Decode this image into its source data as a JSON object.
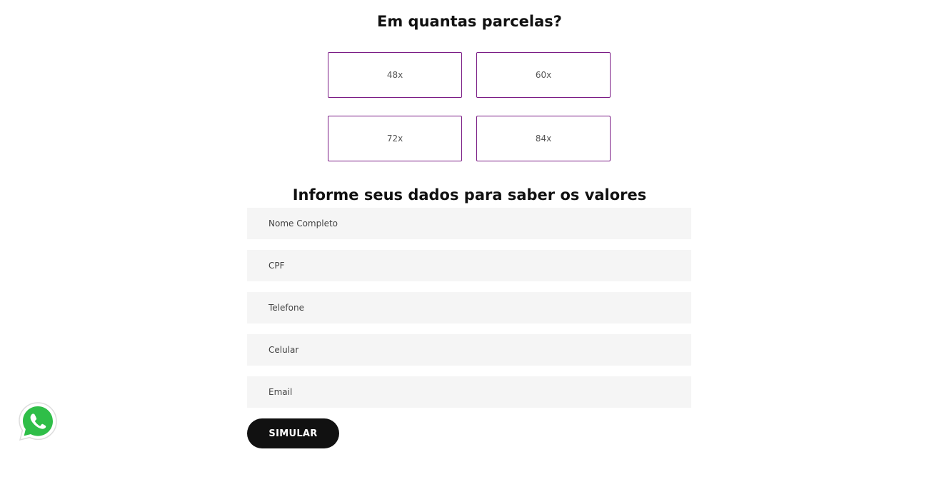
{
  "installments": {
    "title": "Em quantas parcelas?",
    "options": [
      {
        "label": "48x"
      },
      {
        "label": "60x"
      },
      {
        "label": "72x"
      },
      {
        "label": "84x"
      }
    ],
    "accent_color": "#7a1b85"
  },
  "form": {
    "title": "Informe seus dados para saber os valores",
    "fields": [
      {
        "placeholder": "Nome Completo"
      },
      {
        "placeholder": "CPF"
      },
      {
        "placeholder": "Telefone"
      },
      {
        "placeholder": "Celular"
      },
      {
        "placeholder": "Email"
      }
    ],
    "submit_label": "SIMULAR"
  },
  "floating": {
    "whatsapp_icon": "whatsapp-icon",
    "whatsapp_color": "#2fbe48"
  }
}
